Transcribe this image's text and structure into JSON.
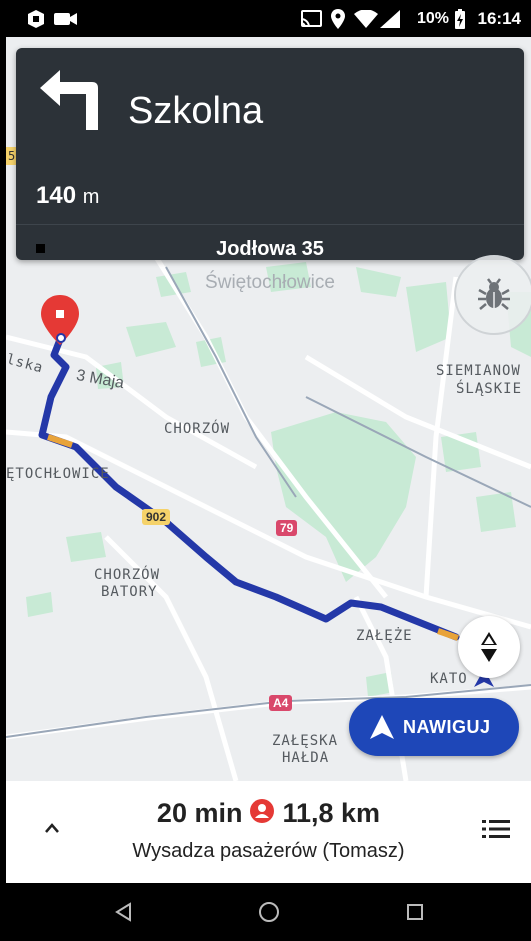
{
  "status_bar": {
    "battery_percent": "10%",
    "time": "16:14",
    "icons": [
      "app-icon",
      "video-camera-icon",
      "cast-icon",
      "location-icon",
      "wifi-icon",
      "signal-icon",
      "battery-charging-icon"
    ]
  },
  "instruction": {
    "maneuver": "turn-left",
    "street": "Szkolna",
    "distance_value": "140",
    "distance_unit": "m"
  },
  "destination": {
    "address": "Jodłowa 35",
    "city": "Świętochłowice"
  },
  "map": {
    "labels": {
      "slaska": "lska",
      "trzeciego_maja": "3 Maja",
      "siemianowice": "SIEMIANOW",
      "slaskie": "ŚLĄSKIE",
      "chorzow": "CHORZÓW",
      "swietochlowice": "ĘTOCHŁOWICE",
      "chorzow_batory_1": "CHORZÓW",
      "chorzow_batory_2": "BATORY",
      "zaleze": "ZAŁĘŻE",
      "katowice": "KATO",
      "zaleska_halda_1": "ZAŁĘSKA",
      "zaleska_halda_2": "HAŁDA",
      "edge_label": "5"
    },
    "shields": {
      "r902": "902",
      "r79": "79",
      "a4": "A4"
    },
    "colors": {
      "route": "#2438a8",
      "traffic": "#e8a33a",
      "green_area": "#c8ead5",
      "shield_yellow": "#f5d26a",
      "shield_red": "#d9486b"
    }
  },
  "buttons": {
    "navigate_label": "NAWIGUJ"
  },
  "trip": {
    "eta": "20 min",
    "distance": "11,8 km",
    "status": "Wysadza pasażerów (Tomasz)"
  },
  "nav_bar": {
    "icons": [
      "back-icon",
      "home-icon",
      "recents-icon"
    ]
  }
}
